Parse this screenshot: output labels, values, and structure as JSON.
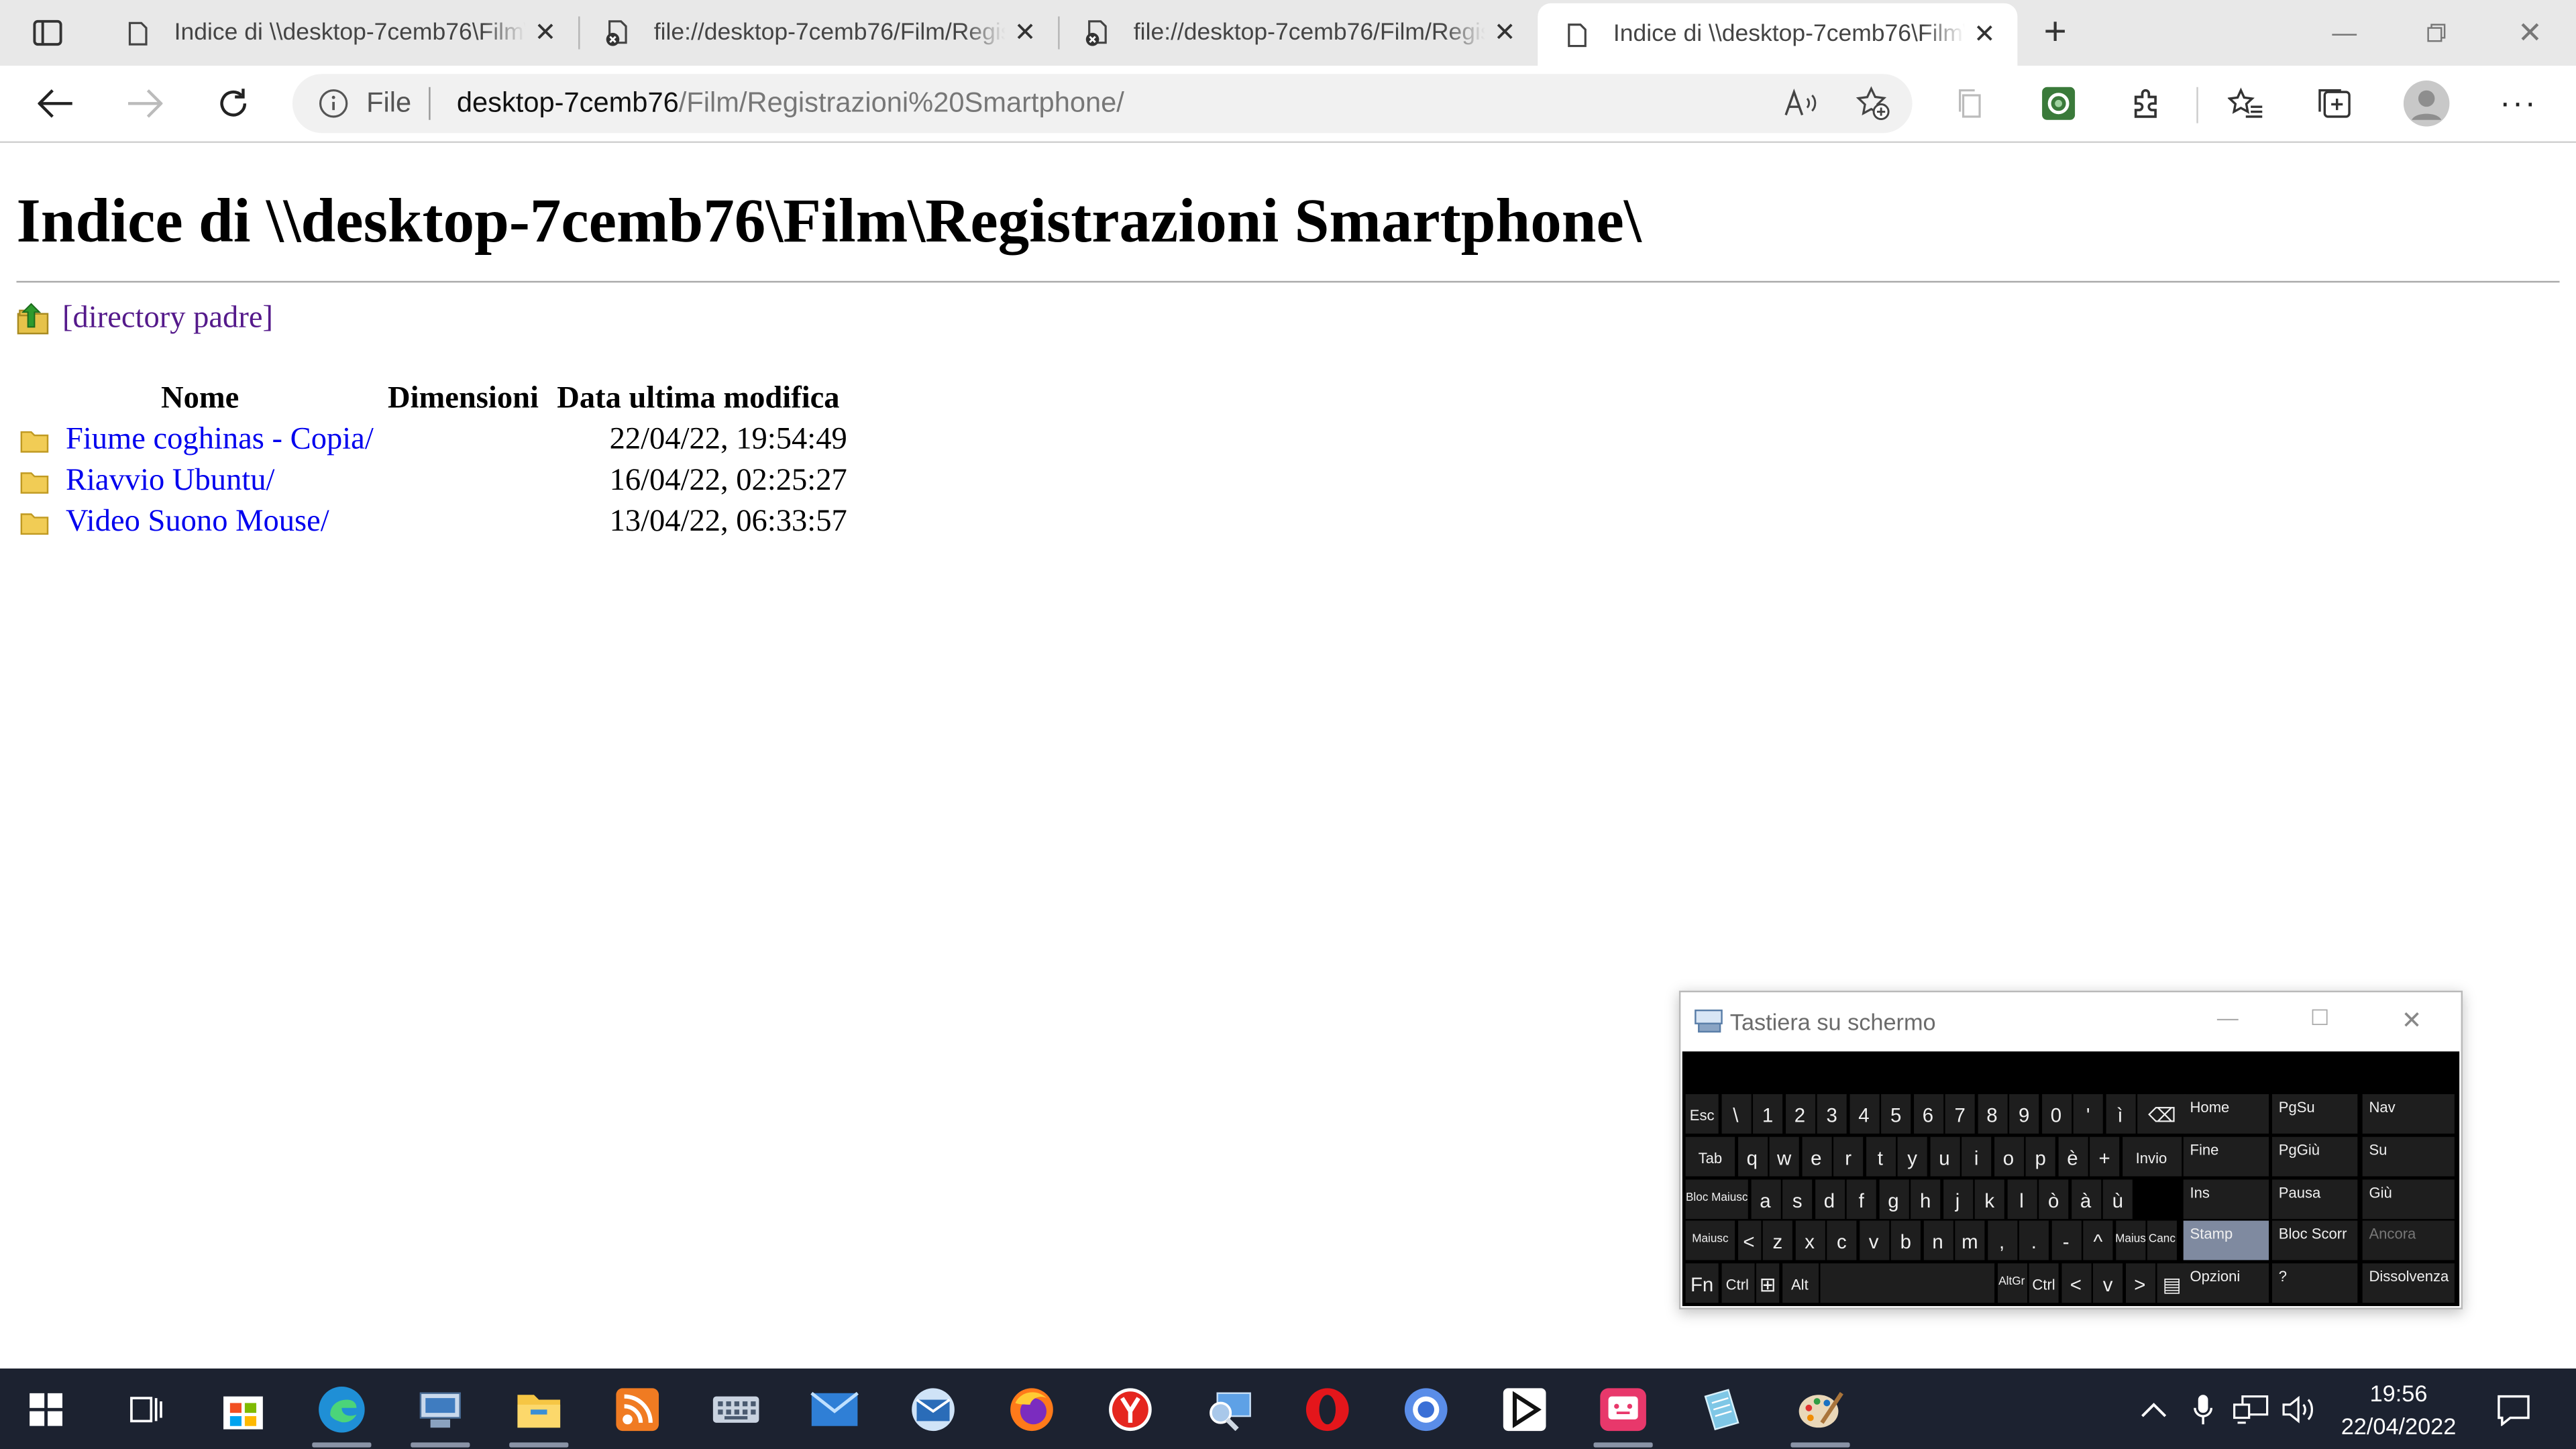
{
  "browser": {
    "tabs": [
      {
        "title": "Indice di \\\\desktop-7cemb76\\Film\\Registrazioni Smartphone\\",
        "icon": "page-icon",
        "active": false
      },
      {
        "title": "file://desktop-7cemb76/Film/Registrazioni%20Smartphone/",
        "icon": "blocked-page-icon",
        "active": false
      },
      {
        "title": "file://desktop-7cemb76/Film/Registrazioni%20Smartphone/",
        "icon": "blocked-page-icon",
        "active": false
      },
      {
        "title": "Indice di \\\\desktop-7cemb76\\Film\\Registrazioni Smartphone\\",
        "icon": "page-icon",
        "active": true
      }
    ],
    "address": {
      "protocol": "File",
      "host": "desktop-7cemb76",
      "path": "/Film/Registrazioni%20Smartphone/"
    }
  },
  "page": {
    "heading": "Indice di \\\\desktop-7cemb76\\Film\\Registrazioni Smartphone\\",
    "parent_link": "[directory padre]",
    "columns": [
      "Nome",
      "Dimensioni",
      "Data ultima modifica"
    ],
    "entries": [
      {
        "name": "Fiume coghinas - Copia/",
        "size": "",
        "modified": "22/04/22, 19:54:49"
      },
      {
        "name": "Riavvio Ubuntu/",
        "size": "",
        "modified": "16/04/22, 02:25:27"
      },
      {
        "name": "Video Suono Mouse/",
        "size": "",
        "modified": "13/04/22, 06:33:57"
      }
    ]
  },
  "osk": {
    "title": "Tastiera su schermo",
    "rows": [
      [
        "Esc",
        "\\",
        "1",
        "2",
        "3",
        "4",
        "5",
        "6",
        "7",
        "8",
        "9",
        "0",
        "'",
        "ì",
        "⌫"
      ],
      [
        "Tab",
        "q",
        "w",
        "e",
        "r",
        "t",
        "y",
        "u",
        "i",
        "o",
        "p",
        "è",
        "+",
        "Invio"
      ],
      [
        "Bloc Maiusc",
        "a",
        "s",
        "d",
        "f",
        "g",
        "h",
        "j",
        "k",
        "l",
        "ò",
        "à",
        "ù"
      ],
      [
        "Maiusc",
        "<",
        "z",
        "x",
        "c",
        "v",
        "b",
        "n",
        "m",
        ",",
        ".",
        "-",
        "^",
        "Maiusc",
        "Canc"
      ],
      [
        "Fn",
        "Ctrl",
        "⊞",
        "Alt",
        "",
        "AltGr",
        "Ctrl",
        "<",
        "v",
        ">",
        "▤"
      ]
    ],
    "nav_keys": [
      [
        "Home",
        "PgSu",
        "Nav"
      ],
      [
        "Fine",
        "PgGiù",
        "Su"
      ],
      [
        "Ins",
        "Pausa",
        "Giù"
      ],
      [
        "Stamp",
        "Bloc Scorr",
        "Ancora"
      ],
      [
        "Opzioni",
        "?",
        "Dissolvenza"
      ]
    ]
  },
  "taskbar": {
    "apps": [
      "start",
      "task-view",
      "microsoft-store",
      "edge",
      "network-scanner",
      "file-explorer",
      "audio-app",
      "keyboard-app",
      "mail",
      "email-client",
      "firefox",
      "yandex",
      "remote-desktop",
      "opera",
      "chrome",
      "media-player",
      "screen-recorder",
      "notepad",
      "paint"
    ],
    "time": "19:56",
    "date": "22/04/2022"
  },
  "colors": {
    "link": "#0000ee",
    "visited": "#551a8b",
    "taskbar": "#1c2230",
    "osk_key": "#1e1e1e",
    "osk_highlight": "#7f8aa0"
  }
}
